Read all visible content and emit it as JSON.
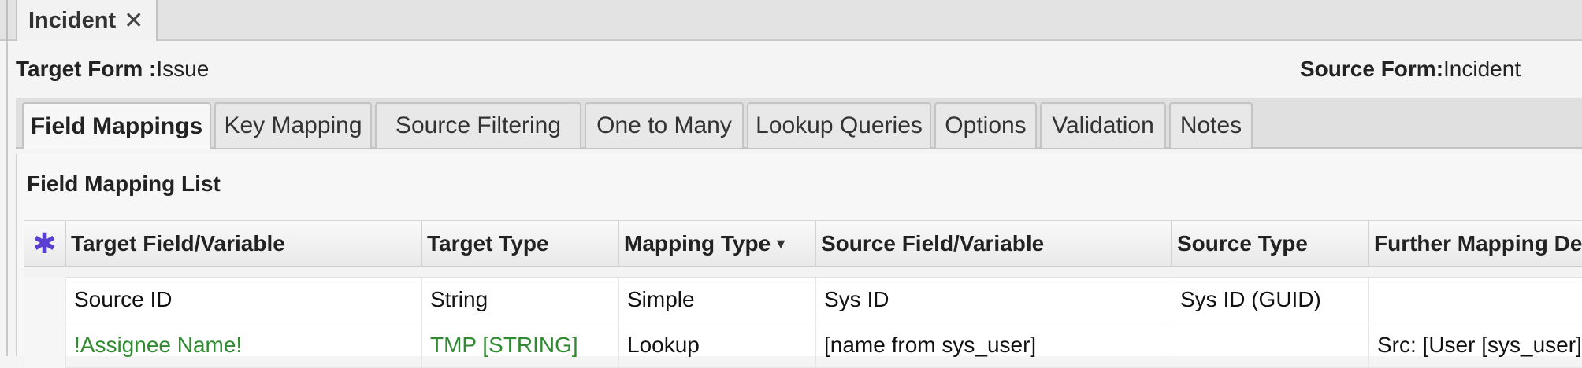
{
  "document_tab": {
    "label": "Incident",
    "close_glyph": "✕"
  },
  "form_info": {
    "target_label": "Target Form :",
    "target_value": "Issue",
    "source_label": "Source Form:",
    "source_value": "Incident"
  },
  "tabs": [
    {
      "label": "Field Mappings",
      "active": true
    },
    {
      "label": "Key Mapping",
      "active": false
    },
    {
      "label": "Source Filtering",
      "active": false
    },
    {
      "label": "One to Many",
      "active": false
    },
    {
      "label": "Lookup Queries",
      "active": false
    },
    {
      "label": "Options",
      "active": false
    },
    {
      "label": "Validation",
      "active": false
    },
    {
      "label": "Notes",
      "active": false
    }
  ],
  "panel": {
    "title": "Field Mapping List"
  },
  "grid": {
    "header_icon": "asterisk-icon",
    "columns": [
      "Target Field/Variable",
      "Target Type",
      "Mapping Type",
      "Source Field/Variable",
      "Source Type",
      "Further Mapping De"
    ],
    "sort_glyph": "▼",
    "rows": [
      [
        "Source ID",
        "String",
        "Simple",
        "Sys ID",
        "Sys ID (GUID)",
        ""
      ],
      [
        "!Assignee Name!",
        "TMP [STRING]",
        "Lookup",
        "[name from sys_user]",
        "",
        "Src: [User [sys_user] :"
      ]
    ]
  },
  "colors": {
    "green_text": "#2f8a30",
    "asterisk": "#5b3fd0"
  }
}
